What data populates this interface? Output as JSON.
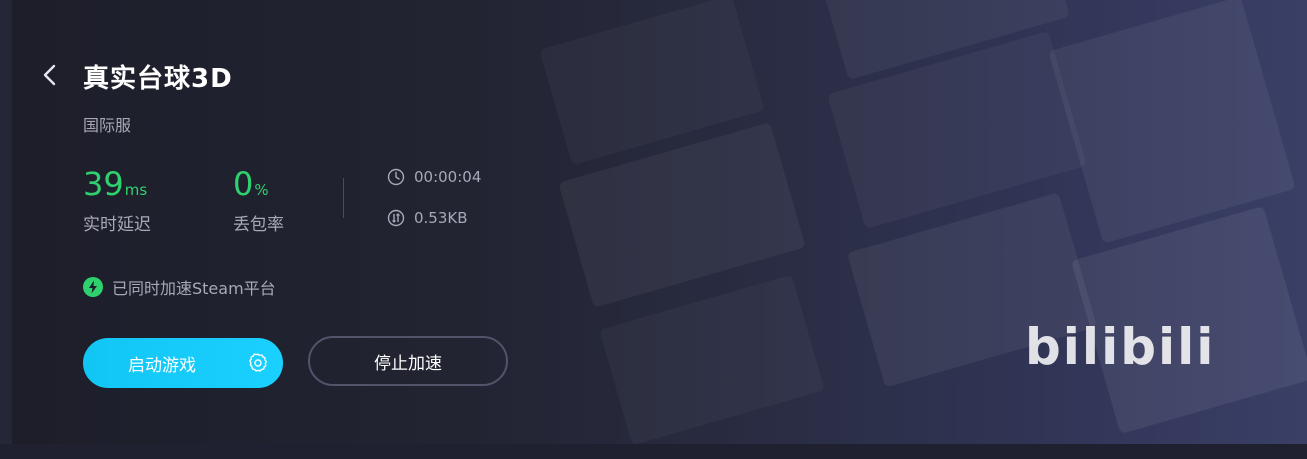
{
  "game": {
    "title": "真实台球3D",
    "region": "国际服"
  },
  "stats": {
    "latency_value": "39",
    "latency_unit": "ms",
    "latency_label": "实时延迟",
    "loss_value": "0",
    "loss_unit": "%",
    "loss_label": "丢包率"
  },
  "meta": {
    "elapsed_time": "00:00:04",
    "traffic": "0.53KB"
  },
  "notice": {
    "steam_text": "已同时加速Steam平台"
  },
  "actions": {
    "launch_label": "启动游戏",
    "stop_label": "停止加速"
  },
  "watermark": "bilibili",
  "colors": {
    "accent_green": "#2fd16f",
    "launch_blue": "#12c6f4",
    "muted_text": "#a7a9b8"
  },
  "icons": {
    "back": "chevron-left-icon",
    "clock": "clock-icon",
    "traffic": "traffic-icon",
    "steam_bolt": "bolt-icon",
    "settings": "gear-icon"
  }
}
